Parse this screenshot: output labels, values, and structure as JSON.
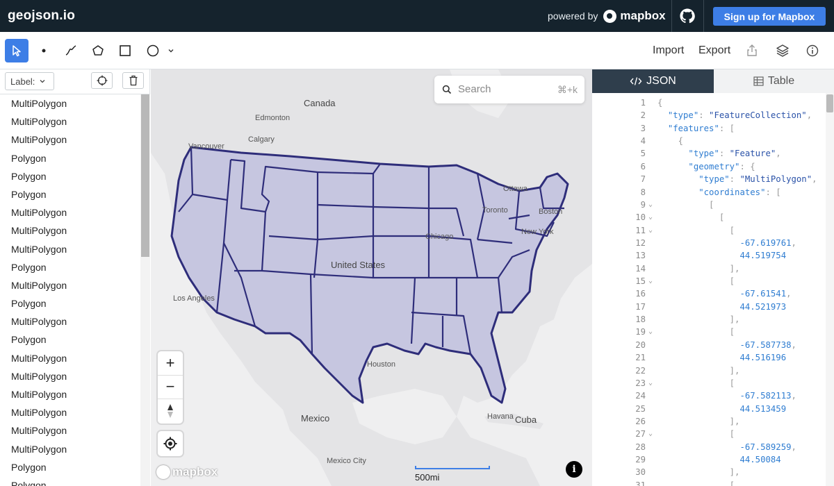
{
  "app": {
    "brand": "geojson.io",
    "powered_by": "powered by",
    "mapbox_name": "mapbox",
    "signup_label": "Sign up for Mapbox"
  },
  "toolbar": {
    "tools": [
      "select-tool",
      "point-tool",
      "line-tool",
      "polygon-tool",
      "rectangle-tool",
      "circle-tool"
    ],
    "import_label": "Import",
    "export_label": "Export"
  },
  "left_panel": {
    "label_select": "Label:",
    "features": [
      "MultiPolygon",
      "MultiPolygon",
      "MultiPolygon",
      "Polygon",
      "Polygon",
      "Polygon",
      "MultiPolygon",
      "MultiPolygon",
      "MultiPolygon",
      "Polygon",
      "MultiPolygon",
      "Polygon",
      "MultiPolygon",
      "Polygon",
      "MultiPolygon",
      "MultiPolygon",
      "MultiPolygon",
      "MultiPolygon",
      "MultiPolygon",
      "MultiPolygon",
      "Polygon",
      "Polygon"
    ]
  },
  "map": {
    "search_placeholder": "Search",
    "search_shortcut": "⌘+k",
    "zoom_in": "+",
    "zoom_out": "−",
    "scale_label": "500mi",
    "attribution": "i",
    "logo_text": "mapbox",
    "place_labels": {
      "canada": "Canada",
      "edmonton": "Edmonton",
      "calgary": "Calgary",
      "vancouver": "Vancouver",
      "ottawa": "Ottawa",
      "toronto": "Toronto",
      "boston": "Boston",
      "new_york": "New York",
      "chicago": "Chicago",
      "united_states": "United States",
      "los_angeles": "Los Angeles",
      "houston": "Houston",
      "mexico": "Mexico",
      "havana": "Havana",
      "cuba": "Cuba",
      "mexico_city": "Mexico City"
    },
    "colors": {
      "fill": "#c6c6e0",
      "stroke": "#2e2d7a",
      "water": "#efeff0",
      "land": "#e3e3e5"
    }
  },
  "right_panel": {
    "tab_json": "JSON",
    "tab_table": "Table",
    "code_lines": [
      {
        "n": "1",
        "fold": "",
        "parts": [
          [
            "p",
            "{"
          ]
        ]
      },
      {
        "n": "2",
        "fold": "",
        "parts": [
          [
            "p",
            "  "
          ],
          [
            "k",
            "\"type\""
          ],
          [
            "p",
            ": "
          ],
          [
            "s",
            "\"FeatureCollection\""
          ],
          [
            "p",
            ","
          ]
        ]
      },
      {
        "n": "3",
        "fold": "",
        "parts": [
          [
            "p",
            "  "
          ],
          [
            "k",
            "\"features\""
          ],
          [
            "p",
            ": ["
          ]
        ]
      },
      {
        "n": "4",
        "fold": "",
        "parts": [
          [
            "p",
            "    {"
          ]
        ]
      },
      {
        "n": "5",
        "fold": "",
        "parts": [
          [
            "p",
            "      "
          ],
          [
            "k",
            "\"type\""
          ],
          [
            "p",
            ": "
          ],
          [
            "s",
            "\"Feature\""
          ],
          [
            "p",
            ","
          ]
        ]
      },
      {
        "n": "6",
        "fold": "",
        "parts": [
          [
            "p",
            "      "
          ],
          [
            "k",
            "\"geometry\""
          ],
          [
            "p",
            ": {"
          ]
        ]
      },
      {
        "n": "7",
        "fold": "",
        "parts": [
          [
            "p",
            "        "
          ],
          [
            "k",
            "\"type\""
          ],
          [
            "p",
            ": "
          ],
          [
            "s",
            "\"MultiPolygon\""
          ],
          [
            "p",
            ","
          ]
        ]
      },
      {
        "n": "8",
        "fold": "",
        "parts": [
          [
            "p",
            "        "
          ],
          [
            "k",
            "\"coordinates\""
          ],
          [
            "p",
            ": ["
          ]
        ]
      },
      {
        "n": "9",
        "fold": "⌄",
        "parts": [
          [
            "p",
            "          ["
          ]
        ]
      },
      {
        "n": "10",
        "fold": "⌄",
        "parts": [
          [
            "p",
            "            ["
          ]
        ]
      },
      {
        "n": "11",
        "fold": "⌄",
        "parts": [
          [
            "p",
            "              ["
          ]
        ]
      },
      {
        "n": "12",
        "fold": "",
        "parts": [
          [
            "p",
            "                "
          ],
          [
            "n",
            "-67.619761"
          ],
          [
            "p",
            ","
          ]
        ]
      },
      {
        "n": "13",
        "fold": "",
        "parts": [
          [
            "p",
            "                "
          ],
          [
            "n",
            "44.519754"
          ]
        ]
      },
      {
        "n": "14",
        "fold": "",
        "parts": [
          [
            "p",
            "              ],"
          ]
        ]
      },
      {
        "n": "15",
        "fold": "⌄",
        "parts": [
          [
            "p",
            "              ["
          ]
        ]
      },
      {
        "n": "16",
        "fold": "",
        "parts": [
          [
            "p",
            "                "
          ],
          [
            "n",
            "-67.61541"
          ],
          [
            "p",
            ","
          ]
        ]
      },
      {
        "n": "17",
        "fold": "",
        "parts": [
          [
            "p",
            "                "
          ],
          [
            "n",
            "44.521973"
          ]
        ]
      },
      {
        "n": "18",
        "fold": "",
        "parts": [
          [
            "p",
            "              ],"
          ]
        ]
      },
      {
        "n": "19",
        "fold": "⌄",
        "parts": [
          [
            "p",
            "              ["
          ]
        ]
      },
      {
        "n": "20",
        "fold": "",
        "parts": [
          [
            "p",
            "                "
          ],
          [
            "n",
            "-67.587738"
          ],
          [
            "p",
            ","
          ]
        ]
      },
      {
        "n": "21",
        "fold": "",
        "parts": [
          [
            "p",
            "                "
          ],
          [
            "n",
            "44.516196"
          ]
        ]
      },
      {
        "n": "22",
        "fold": "",
        "parts": [
          [
            "p",
            "              ],"
          ]
        ]
      },
      {
        "n": "23",
        "fold": "⌄",
        "parts": [
          [
            "p",
            "              ["
          ]
        ]
      },
      {
        "n": "24",
        "fold": "",
        "parts": [
          [
            "p",
            "                "
          ],
          [
            "n",
            "-67.582113"
          ],
          [
            "p",
            ","
          ]
        ]
      },
      {
        "n": "25",
        "fold": "",
        "parts": [
          [
            "p",
            "                "
          ],
          [
            "n",
            "44.513459"
          ]
        ]
      },
      {
        "n": "26",
        "fold": "",
        "parts": [
          [
            "p",
            "              ],"
          ]
        ]
      },
      {
        "n": "27",
        "fold": "⌄",
        "parts": [
          [
            "p",
            "              ["
          ]
        ]
      },
      {
        "n": "28",
        "fold": "",
        "parts": [
          [
            "p",
            "                "
          ],
          [
            "n",
            "-67.589259"
          ],
          [
            "p",
            ","
          ]
        ]
      },
      {
        "n": "29",
        "fold": "",
        "parts": [
          [
            "p",
            "                "
          ],
          [
            "n",
            "44.50084"
          ]
        ]
      },
      {
        "n": "30",
        "fold": "",
        "parts": [
          [
            "p",
            "              ],"
          ]
        ]
      },
      {
        "n": "31",
        "fold": "",
        "parts": [
          [
            "p",
            "              ["
          ]
        ]
      }
    ]
  }
}
